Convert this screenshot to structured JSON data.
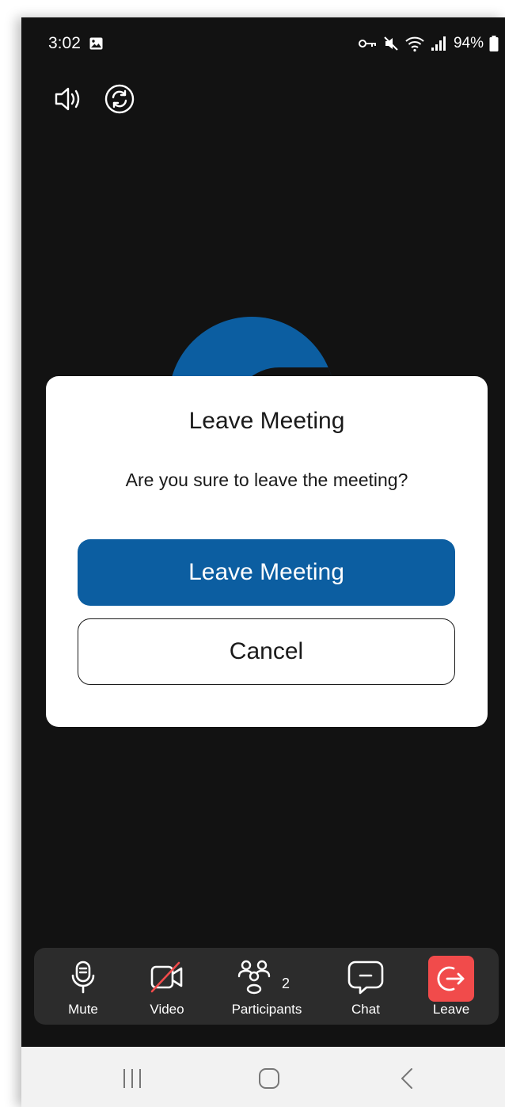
{
  "status_bar": {
    "time": "3:02",
    "battery": "94%",
    "icons": [
      "gallery-icon",
      "key-icon",
      "mute-icon",
      "wifi-icon",
      "signal-icon",
      "battery-icon"
    ]
  },
  "top_controls": [
    "speaker-icon",
    "switch-camera-icon"
  ],
  "dialog": {
    "title": "Leave Meeting",
    "message": "Are you sure to leave the meeting?",
    "primary_label": "Leave Meeting",
    "cancel_label": "Cancel"
  },
  "toolbar": {
    "mute_label": "Mute",
    "video_label": "Video",
    "participants_label": "Participants",
    "participants_count": "2",
    "chat_label": "Chat",
    "leave_label": "Leave"
  },
  "colors": {
    "background": "#121212",
    "accent": "#0c5ea1",
    "leave": "#f14b4b",
    "toolbar": "#2c2c2c",
    "navbar": "#f2f2f2"
  },
  "nav_bar": [
    "recent-apps-icon",
    "home-icon",
    "back-icon"
  ]
}
